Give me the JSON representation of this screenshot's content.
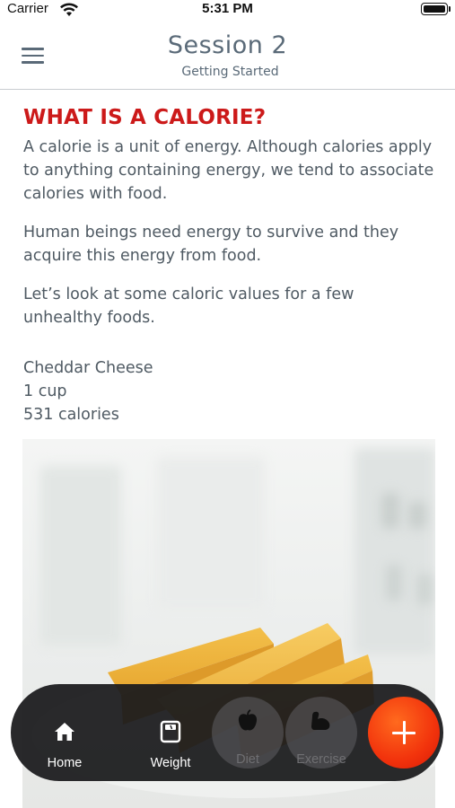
{
  "status_bar": {
    "carrier": "Carrier",
    "time": "5:31 PM"
  },
  "header": {
    "title": "Session 2",
    "subtitle": "Getting Started"
  },
  "article": {
    "heading": "WHAT IS A CALORIE?",
    "paragraphs": [
      "A calorie is a unit of energy. Although calories apply to anything containing energy, we tend to associate calories with food.",
      "Human beings need energy to survive and they acquire this energy from food.",
      "Let’s look at some caloric values for a few unhealthy foods."
    ],
    "food": {
      "name": "Cheddar Cheese",
      "serving": "1 cup",
      "calories": "531 calories"
    }
  },
  "bottom_nav": {
    "items": [
      {
        "label": "Home",
        "icon": "home-icon"
      },
      {
        "label": "Weight",
        "icon": "scale-icon"
      },
      {
        "label": "Diet",
        "icon": "apple-icon"
      },
      {
        "label": "Exercise",
        "icon": "flexed-arm-icon"
      }
    ],
    "fab_icon": "plus-icon"
  },
  "colors": {
    "heading": "#cc1a1a",
    "header_text": "#5a6a78",
    "body_text": "#4f5a63",
    "nav_bg": "#1c1c1e",
    "fab": "#f2330c"
  }
}
